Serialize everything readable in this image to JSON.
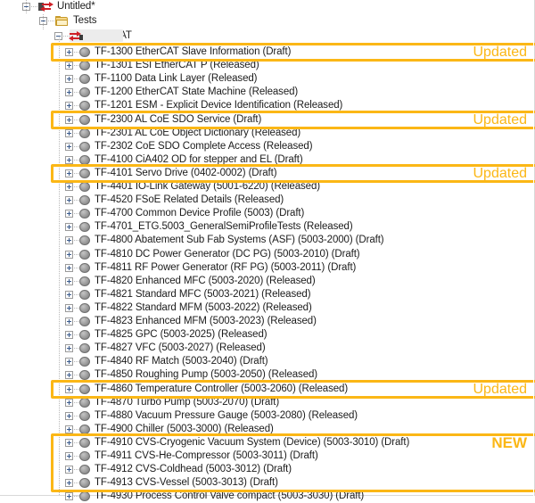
{
  "window": {
    "title": "Untitled*",
    "root_icon": "ethercat-document-icon"
  },
  "tree": {
    "root": {
      "label": "Untitled*",
      "icon": "ethercat-document-icon",
      "expander": "minus"
    },
    "tests_folder": {
      "label": "Tests",
      "icon": "folder-icon",
      "expander": "minus"
    },
    "ethercat_group": {
      "label": "EtherCAT",
      "icon": "ethercat-icon",
      "expander": "minus"
    },
    "items": [
      {
        "label": "TF-1300 EtherCAT Slave Information (Draft)",
        "status": "Draft",
        "highlight": true
      },
      {
        "label": "TF-1301 ESI EtherCAT P (Released)",
        "status": "Released",
        "highlight": false
      },
      {
        "label": "TF-1100 Data Link Layer (Released)",
        "status": "Released",
        "highlight": false
      },
      {
        "label": "TF-1200 EtherCAT State Machine (Released)",
        "status": "Released",
        "highlight": false
      },
      {
        "label": "TF-1201 ESM - Explicit Device Identification (Released)",
        "status": "Released",
        "highlight": false
      },
      {
        "label": "TF-2300 AL CoE SDO Service (Draft)",
        "status": "Draft",
        "highlight": true
      },
      {
        "label": "TF-2301 AL CoE Object Dictionary (Released)",
        "status": "Released",
        "highlight": false
      },
      {
        "label": "TF-2302 CoE SDO Complete Access (Released)",
        "status": "Released",
        "highlight": false
      },
      {
        "label": "TF-4100 CiA402 OD for stepper and EL (Draft)",
        "status": "Draft",
        "highlight": false
      },
      {
        "label": "TF-4101 Servo Drive (0402-0002) (Draft)",
        "status": "Draft",
        "highlight": true
      },
      {
        "label": "TF-4401 IO-Link Gateway (5001-6220) (Released)",
        "status": "Released",
        "highlight": false
      },
      {
        "label": "TF-4520 FSoE Related Details (Released)",
        "status": "Released",
        "highlight": false
      },
      {
        "label": "TF-4700 Common Device Profile (5003) (Draft)",
        "status": "Draft",
        "highlight": false
      },
      {
        "label": "TF-4701_ETG.5003_GeneralSemiProfileTests (Released)",
        "status": "Released",
        "highlight": false
      },
      {
        "label": "TF-4800 Abatement Sub Fab Systems (ASF) (5003-2000) (Draft)",
        "status": "Draft",
        "highlight": false
      },
      {
        "label": "TF-4810 DC Power Generator (DC PG) (5003-2010) (Draft)",
        "status": "Draft",
        "highlight": false
      },
      {
        "label": "TF-4811 RF Power Generator (RF PG) (5003-2011) (Draft)",
        "status": "Draft",
        "highlight": false
      },
      {
        "label": "TF-4820 Enhanced MFC (5003-2020) (Released)",
        "status": "Released",
        "highlight": false
      },
      {
        "label": "TF-4821 Standard MFC (5003-2021) (Released)",
        "status": "Released",
        "highlight": false
      },
      {
        "label": "TF-4822 Standard MFM (5003-2022) (Released)",
        "status": "Released",
        "highlight": false
      },
      {
        "label": "TF-4823 Enhanced MFM (5003-2023) (Released)",
        "status": "Released",
        "highlight": false
      },
      {
        "label": "TF-4825 GPC (5003-2025) (Released)",
        "status": "Released",
        "highlight": false
      },
      {
        "label": "TF-4827 VFC (5003-2027) (Released)",
        "status": "Released",
        "highlight": false
      },
      {
        "label": "TF-4840 RF Match (5003-2040) (Draft)",
        "status": "Draft",
        "highlight": false
      },
      {
        "label": "TF-4850 Roughing Pump (5003-2050) (Released)",
        "status": "Released",
        "highlight": false
      },
      {
        "label": "TF-4860 Temperature Controller (5003-2060) (Released)",
        "status": "Released",
        "highlight": true
      },
      {
        "label": "TF-4870 Turbo Pump (5003-2070) (Draft)",
        "status": "Draft",
        "highlight": false
      },
      {
        "label": "TF-4880 Vacuum Pressure Gauge (5003-2080) (Released)",
        "status": "Released",
        "highlight": false
      },
      {
        "label": "TF-4900 Chiller (5003-3000) (Released)",
        "status": "Released",
        "highlight": false
      },
      {
        "label": "TF-4910 CVS-Cryogenic Vacuum System (Device) (5003-3010) (Draft)",
        "status": "Draft",
        "highlight": true
      },
      {
        "label": "TF-4911 CVS-He-Compressor (5003-3011) (Draft)",
        "status": "Draft",
        "highlight": true
      },
      {
        "label": "TF-4912 CVS-Coldhead (5003-3012) (Draft)",
        "status": "Draft",
        "highlight": true
      },
      {
        "label": "TF-4913 CVS-Vessel (5003-3013) (Draft)",
        "status": "Draft",
        "highlight": true
      },
      {
        "label": "TF-4930 Process Control Valve compact (5003-3030) (Draft)",
        "status": "Draft",
        "highlight": false
      }
    ]
  },
  "annotations": {
    "highlight_color": "#FBB716",
    "items": [
      {
        "text": "Updated",
        "emphasis": "normal",
        "target": "TF-1300 EtherCAT Slave Information (Draft)"
      },
      {
        "text": "Updated",
        "emphasis": "normal",
        "target": "TF-2300 AL CoE SDO Service (Draft)"
      },
      {
        "text": "Updated",
        "emphasis": "normal",
        "target": "TF-4101 Servo Drive (0402-0002) (Draft)"
      },
      {
        "text": "Updated",
        "emphasis": "normal",
        "target": "TF-4860 Temperature Controller (5003-2060) (Released)"
      },
      {
        "text": "NEW",
        "emphasis": "bold",
        "target": "TF-4910 CVS-Cryogenic Vacuum System (Device) (5003-3010) (Draft)"
      }
    ]
  }
}
